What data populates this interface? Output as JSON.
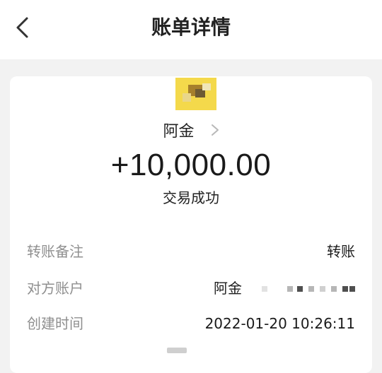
{
  "header": {
    "title": "账单详情",
    "back_icon": "back-chevron-icon"
  },
  "payee": {
    "name": "阿金",
    "chevron_icon": "chevron-right-icon"
  },
  "transaction": {
    "amount": "+10,000.00",
    "status": "交易成功"
  },
  "details": {
    "note_label": "转账备注",
    "note_value": "转账",
    "counterparty_label": "对方账户",
    "counterparty_name": "阿金",
    "created_label": "创建时间",
    "created_value": "2022-01-20 10:26:11"
  },
  "colors": {
    "background": "#f2f2f2",
    "card": "#ffffff",
    "label_gray": "#8f8f8f",
    "avatar_yellow": "#f4d94b"
  }
}
